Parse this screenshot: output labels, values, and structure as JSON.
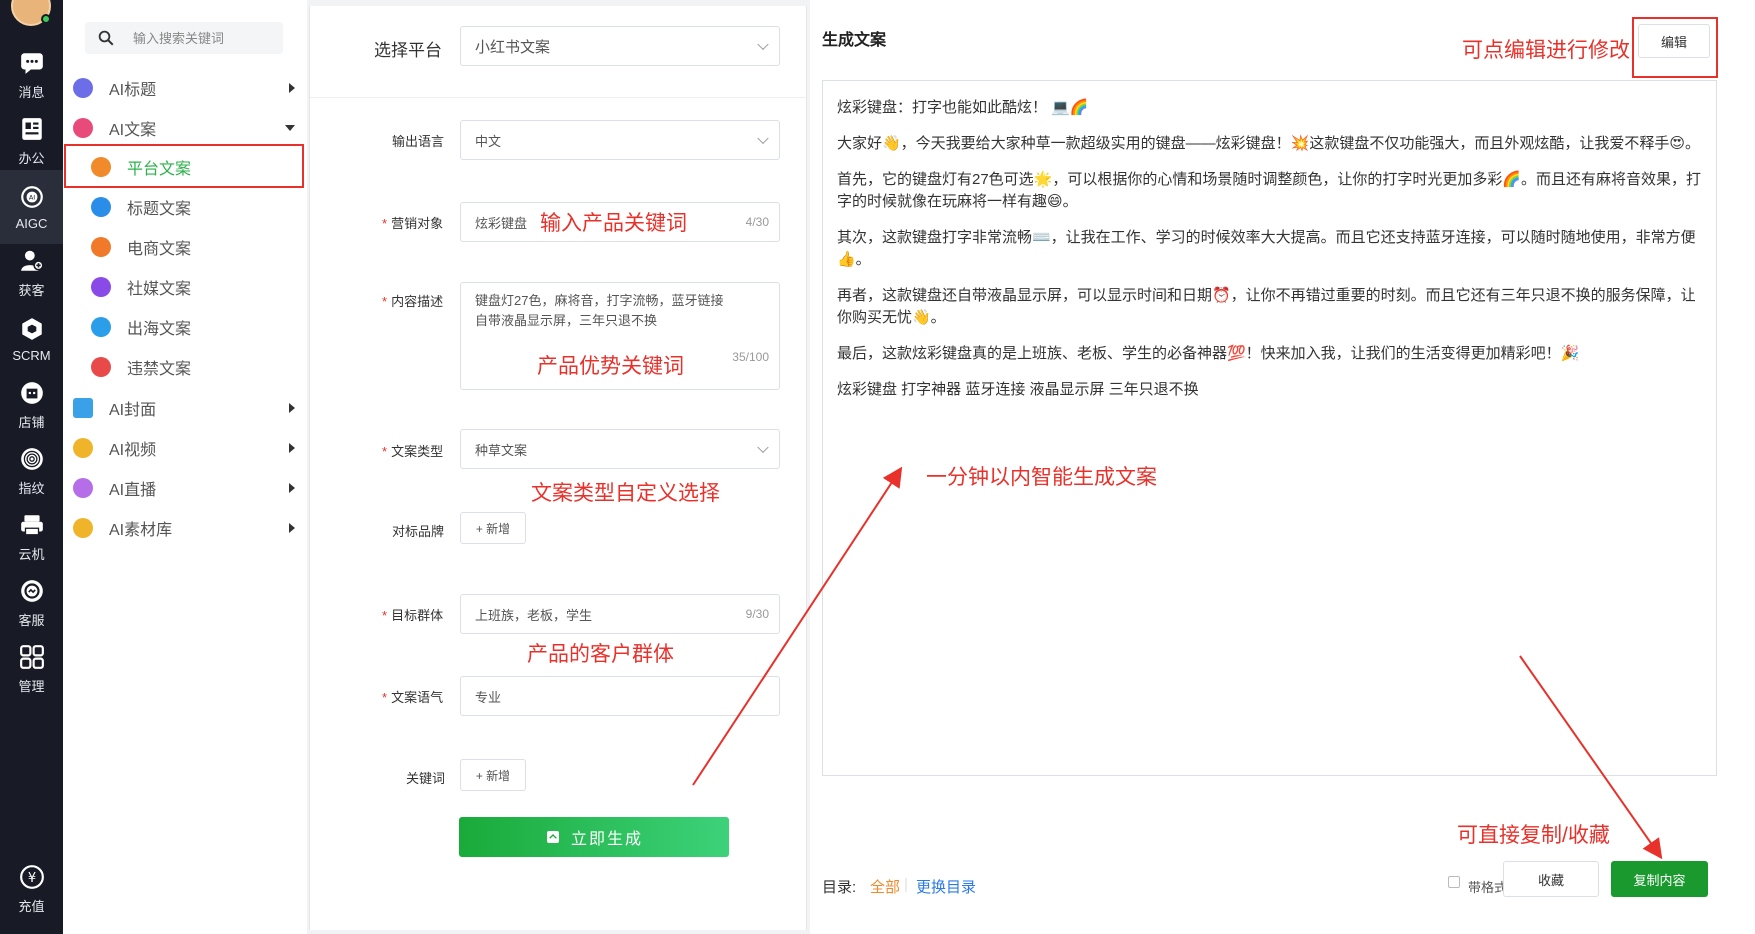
{
  "rail": {
    "items": [
      {
        "label": "消息",
        "icon": "chat-icon"
      },
      {
        "label": "办公",
        "icon": "office-icon"
      },
      {
        "label": "AIGC",
        "icon": "ai-icon"
      },
      {
        "label": "获客",
        "icon": "add-user-icon"
      },
      {
        "label": "SCRM",
        "icon": "scrm-icon"
      },
      {
        "label": "店铺",
        "icon": "store-icon"
      },
      {
        "label": "指纹",
        "icon": "fingerprint-icon"
      },
      {
        "label": "云机",
        "icon": "cloud-machine-icon"
      },
      {
        "label": "客服",
        "icon": "support-icon"
      },
      {
        "label": "管理",
        "icon": "grid-icon"
      },
      {
        "label": "充值",
        "icon": "recharge-icon"
      }
    ]
  },
  "menu": {
    "search_placeholder": "输入搜索关键词",
    "groups": [
      {
        "label": "AI标题",
        "color": "#6c6ee8"
      },
      {
        "label": "AI文案",
        "color": "#e84a7a"
      },
      {
        "label": "AI封面",
        "color": "#3aa0e8"
      },
      {
        "label": "AI视频",
        "color": "#f0b42a"
      },
      {
        "label": "AI直播",
        "color": "#b56ee8"
      },
      {
        "label": "AI素材库",
        "color": "#f0b42a"
      }
    ],
    "subs": [
      {
        "label": "平台文案",
        "color": "#f08a2a"
      },
      {
        "label": "标题文案",
        "color": "#2a8ee8"
      },
      {
        "label": "电商文案",
        "color": "#f07a2a"
      },
      {
        "label": "社媒文案",
        "color": "#8a4ae8"
      },
      {
        "label": "出海文案",
        "color": "#2a9ee8"
      },
      {
        "label": "违禁文案",
        "color": "#e84a4a"
      }
    ]
  },
  "form": {
    "platform_label": "选择平台",
    "platform_value": "小红书文案",
    "language_label": "输出语言",
    "language_value": "中文",
    "target_label": "营销对象",
    "target_value": "炫彩键盘",
    "target_count": "4/30",
    "desc_label": "内容描述",
    "desc_value": "键盘灯27色，麻将音，打字流畅，蓝牙链接\n自带液晶显示屏，三年只退不换",
    "desc_count": "35/100",
    "type_label": "文案类型",
    "type_value": "种草文案",
    "brand_label": "对标品牌",
    "add_label": "+ 新增",
    "audience_label": "目标群体",
    "audience_value": "上班族，老板，学生",
    "audience_count": "9/30",
    "tone_label": "文案语气",
    "tone_value": "专业",
    "keyword_label": "关键词",
    "generate_label": "立即生成"
  },
  "result": {
    "title": "生成文案",
    "edit_label": "编辑",
    "paragraphs": [
      "炫彩键盘：打字也能如此酷炫！ 💻🌈",
      "大家好👋，今天我要给大家种草一款超级实用的键盘——炫彩键盘！💥这款键盘不仅功能强大，而且外观炫酷，让我爱不释手😍。",
      "首先，它的键盘灯有27色可选🌟，可以根据你的心情和场景随时调整颜色，让你的打字时光更加多彩🌈。而且还有麻将音效果，打字的时候就像在玩麻将一样有趣😄。",
      "其次，这款键盘打字非常流畅⌨️，让我在工作、学习的时候效率大大提高。而且它还支持蓝牙连接，可以随时随地使用，非常方便👍。",
      "再者，这款键盘还自带液晶显示屏，可以显示时间和日期⏰，让你不再错过重要的时刻。而且它还有三年只退不换的服务保障，让你购买无忧👋。",
      "最后，这款炫彩键盘真的是上班族、老板、学生的必备神器💯！快来加入我，让我们的生活变得更加精彩吧！🎉",
      "炫彩键盘 打字神器 蓝牙连接 液晶显示屏 三年只退不换"
    ],
    "catalog_label": "目录:",
    "catalog_all": "全部",
    "catalog_change": "更换目录",
    "format_label": "带格式",
    "favorite_label": "收藏",
    "copy_label": "复制内容"
  },
  "annotations": {
    "edit_hint": "可点编辑进行修改",
    "keyword_hint": "输入产品关键词",
    "advantage_hint": "产品优势关键词",
    "type_hint": "文案类型自定义选择",
    "audience_hint": "产品的客户群体",
    "generate_hint": "一分钟以内智能生成文案",
    "copy_hint": "可直接复制/收藏"
  },
  "colors": {
    "accent_green": "#2cb24a",
    "annotation_red": "#e8312a",
    "rail_bg": "#181b25",
    "link_blue": "#2a7ae8",
    "catalog_orange": "#f08a2a"
  }
}
